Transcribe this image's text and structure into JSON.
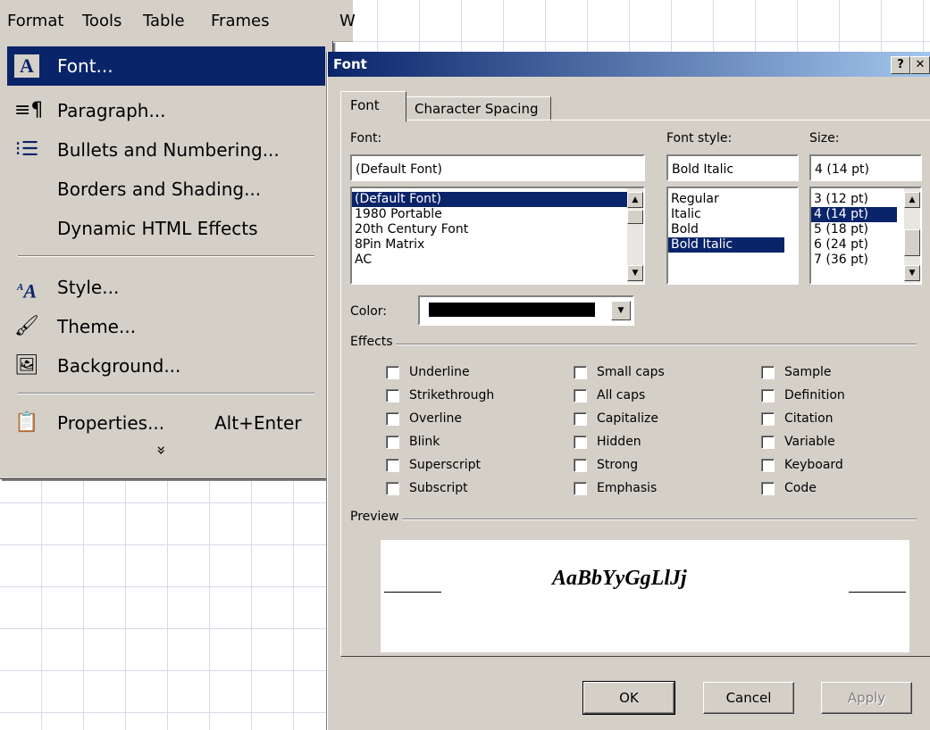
{
  "menubar": {
    "items": [
      "Format",
      "Tools",
      "Table",
      "Frames",
      "W"
    ]
  },
  "menu": {
    "items": [
      {
        "icon": "font-icon",
        "label": "Font..."
      },
      {
        "icon": "paragraph-icon",
        "label": "Paragraph..."
      },
      {
        "icon": "bullets-icon",
        "label": "Bullets and Numbering..."
      },
      {
        "icon": "",
        "label": "Borders and Shading..."
      },
      {
        "icon": "",
        "label": "Dynamic HTML Effects"
      },
      {
        "icon": "style-icon",
        "label": "Style..."
      },
      {
        "icon": "theme-icon",
        "label": "Theme..."
      },
      {
        "icon": "background-icon",
        "label": "Background..."
      },
      {
        "icon": "properties-icon",
        "label": "Properties...",
        "accel": "Alt+Enter"
      }
    ],
    "expand": "»"
  },
  "dialog": {
    "title": "Font",
    "help_label": "?",
    "close_label": "✕",
    "tabs": [
      "Font",
      "Character Spacing"
    ],
    "font_label": "Font:",
    "font_value": "(Default Font)",
    "font_list": [
      "(Default Font)",
      "1980 Portable",
      "20th Century Font",
      "8Pin Matrix",
      "AC"
    ],
    "style_label": "Font style:",
    "style_value": "Bold Italic",
    "style_list": [
      "Regular",
      "Italic",
      "Bold",
      "Bold Italic"
    ],
    "size_label": "Size:",
    "size_value": "4 (14 pt)",
    "size_list": [
      "3 (12 pt)",
      "4 (14 pt)",
      "5 (18 pt)",
      "6 (24 pt)",
      "7 (36 pt)"
    ],
    "color_label": "Color:",
    "color_value": "#000000",
    "effects_label": "Effects",
    "effects": [
      [
        "Underline",
        "Strikethrough",
        "Overline",
        "Blink",
        "Superscript",
        "Subscript"
      ],
      [
        "Small caps",
        "All caps",
        "Capitalize",
        "Hidden",
        "Strong",
        "Emphasis"
      ],
      [
        "Sample",
        "Definition",
        "Citation",
        "Variable",
        "Keyboard",
        "Code"
      ]
    ],
    "preview_label": "Preview",
    "preview_text": "AaBbYyGgLlJj",
    "ok_label": "OK",
    "cancel_label": "Cancel",
    "apply_label": "Apply"
  }
}
